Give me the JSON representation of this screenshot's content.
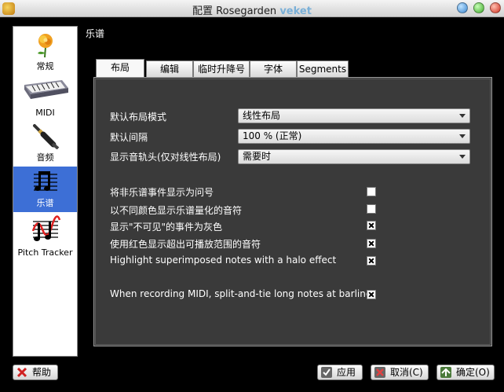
{
  "window": {
    "title_prefix": "配置 Rosegarden",
    "title_brand": "veket"
  },
  "sidebar": {
    "items": [
      {
        "label": "常规"
      },
      {
        "label": "MIDI"
      },
      {
        "label": "音频"
      },
      {
        "label": "乐谱",
        "selected": true
      },
      {
        "label": "Pitch Tracker"
      }
    ]
  },
  "section_title": "乐谱",
  "tabs": [
    {
      "label": "布局",
      "active": true
    },
    {
      "label": "编辑"
    },
    {
      "label": "临时升降号"
    },
    {
      "label": "字体"
    },
    {
      "label": "Segments"
    }
  ],
  "settings": {
    "default_layout_mode": {
      "label": "默认布局模式",
      "value": "线性布局"
    },
    "default_spacing": {
      "label": "默认间隔",
      "value": "100 % (正常)"
    },
    "show_track_headers": {
      "label": "显示音轨头(仅对线性布局)",
      "value": "需要时"
    }
  },
  "checkboxes": [
    {
      "label": "将非乐谱事件显示为问号",
      "checked": false
    },
    {
      "label": "以不同颜色显示乐谱量化的音符",
      "checked": false
    },
    {
      "label": "显示\"不可见\"的事件为灰色",
      "checked": true
    },
    {
      "label": "使用红色显示超出可播放范围的音符",
      "checked": true
    },
    {
      "label": "Highlight superimposed notes with a halo effect",
      "checked": true
    },
    {
      "label": "When recording MIDI, split-and-tie long notes at barlines",
      "checked": true
    }
  ],
  "buttons": {
    "help": "帮助",
    "apply": "应用",
    "cancel": "取消(C)",
    "ok": "确定(O)"
  }
}
